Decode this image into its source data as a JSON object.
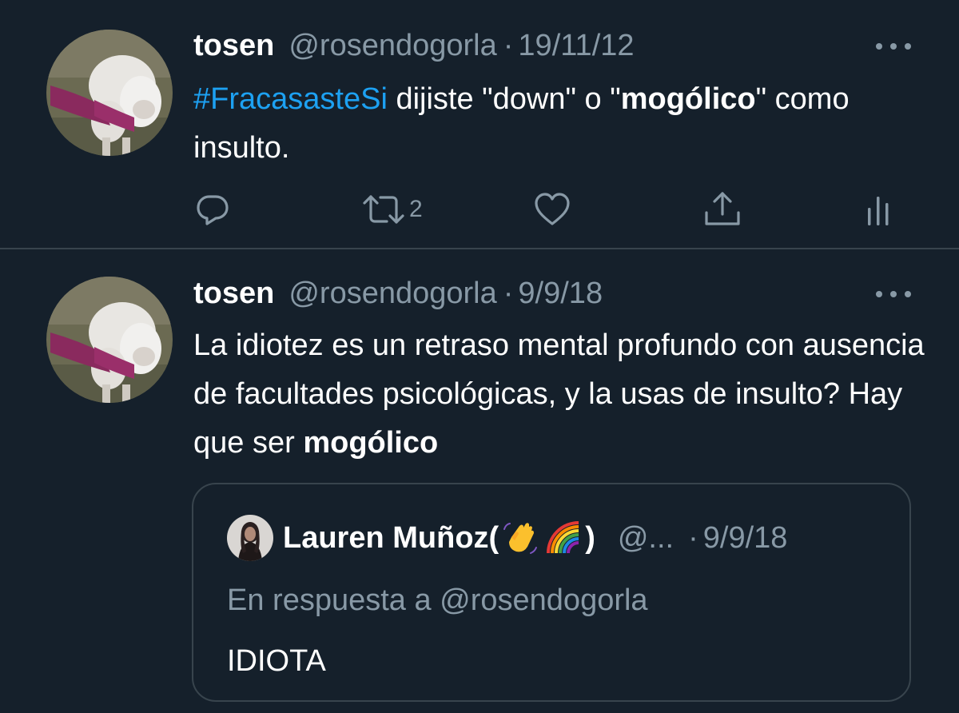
{
  "tweets": [
    {
      "name": "tosen",
      "handle": "@rosendogorla",
      "separator": "·",
      "date": "19/11/12",
      "hashtag": "#FracasasteSi",
      "text_part1": " dijiste \"down\" o \"",
      "text_bold": "mogólico",
      "text_part2": "\" como insulto.",
      "retweet_count": "2"
    },
    {
      "name": "tosen",
      "handle": "@rosendogorla",
      "separator": "·",
      "date": "9/9/18",
      "text_part1": "La idiotez es un retraso mental profundo con ausencia de facultades psicológicas, y la usas de insulto? Hay que ser ",
      "text_bold": "mogólico",
      "quoted": {
        "name": "Lauren Muñoz(",
        "name_close": ")",
        "emojis": [
          "waving-hand",
          "rainbow"
        ],
        "handle": "@...",
        "separator": "·",
        "date": "9/9/18",
        "replying_to": "En respuesta a @rosendogorla",
        "text": "IDIOTA"
      }
    }
  ],
  "icons": [
    "reply-icon",
    "retweet-icon",
    "like-icon",
    "share-icon",
    "analytics-icon",
    "more-icon"
  ],
  "colors": {
    "background": "#15202b",
    "border": "#38444d",
    "secondary_text": "#8899a6",
    "link": "#1da1f2",
    "primary_text": "#ffffff"
  }
}
